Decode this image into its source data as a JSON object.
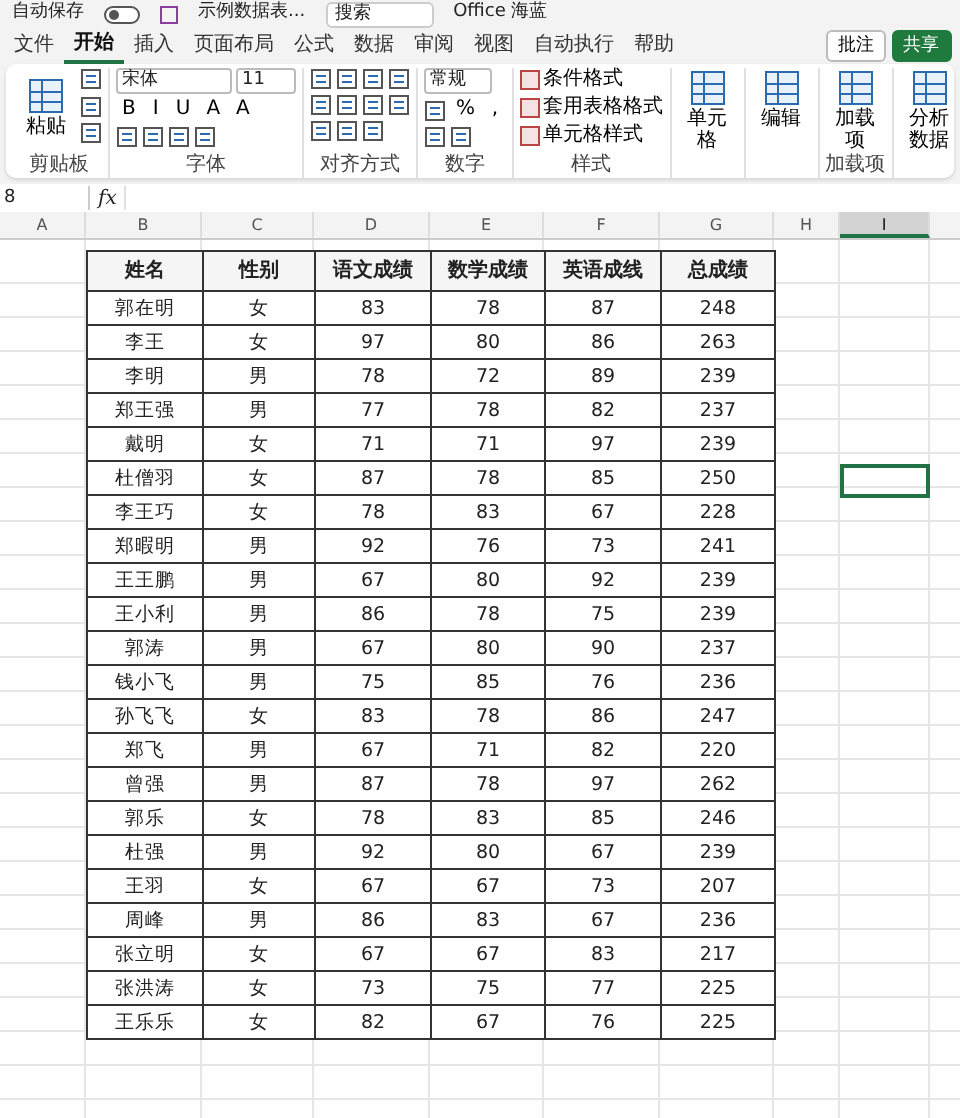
{
  "title_bar": {
    "autosave": "自动保存",
    "document": "示例数据表...",
    "search": "搜索",
    "account": "Office 海蓝"
  },
  "tabs": [
    {
      "label": "文件",
      "selected": false
    },
    {
      "label": "开始",
      "selected": true
    },
    {
      "label": "插入",
      "selected": false
    },
    {
      "label": "页面布局",
      "selected": false
    },
    {
      "label": "公式",
      "selected": false
    },
    {
      "label": "数据",
      "selected": false
    },
    {
      "label": "审阅",
      "selected": false
    },
    {
      "label": "视图",
      "selected": false
    },
    {
      "label": "自动执行",
      "selected": false
    },
    {
      "label": "帮助",
      "selected": false
    }
  ],
  "tab_buttons": [
    {
      "label": "批注",
      "kind": "outline"
    },
    {
      "label": "共享",
      "kind": "primary"
    }
  ],
  "ribbon_groups": [
    {
      "label": "剪贴板",
      "tool_lines": [
        {
          "tools": [
            {
              "kind": "big",
              "label": "粘贴"
            },
            {
              "kind": "stack",
              "tools": [
                {
                  "kind": "icon"
                },
                {
                  "kind": "icon"
                },
                {
                  "kind": "icon"
                }
              ]
            }
          ]
        }
      ]
    },
    {
      "label": "字体",
      "tool_lines": [
        {
          "tools": [
            {
              "kind": "dropdown",
              "value": "宋体"
            },
            {
              "kind": "dropdown",
              "value": "11"
            }
          ]
        },
        {
          "tools": [
            {
              "kind": "glyph",
              "text": "B"
            },
            {
              "kind": "glyph",
              "text": "I"
            },
            {
              "kind": "glyph",
              "text": "U"
            },
            {
              "kind": "glyph",
              "text": "A"
            },
            {
              "kind": "glyph",
              "text": "A"
            }
          ]
        },
        {
          "tools": [
            {
              "kind": "icon"
            },
            {
              "kind": "icon"
            },
            {
              "kind": "icon"
            },
            {
              "kind": "icon"
            }
          ]
        }
      ]
    },
    {
      "label": "对齐方式",
      "tool_lines": [
        {
          "tools": [
            {
              "kind": "icon"
            },
            {
              "kind": "icon"
            },
            {
              "kind": "icon"
            },
            {
              "kind": "icon"
            }
          ]
        },
        {
          "tools": [
            {
              "kind": "icon"
            },
            {
              "kind": "icon"
            },
            {
              "kind": "icon"
            },
            {
              "kind": "icon"
            }
          ]
        },
        {
          "tools": [
            {
              "kind": "icon"
            },
            {
              "kind": "icon"
            },
            {
              "kind": "icon"
            }
          ]
        }
      ]
    },
    {
      "label": "数字",
      "tool_lines": [
        {
          "tools": [
            {
              "kind": "dropdown",
              "value": "常规"
            }
          ]
        },
        {
          "tools": [
            {
              "kind": "icon"
            },
            {
              "kind": "glyph",
              "text": "%"
            },
            {
              "kind": "glyph",
              "text": ","
            }
          ]
        },
        {
          "tools": [
            {
              "kind": "icon"
            },
            {
              "kind": "icon"
            }
          ]
        }
      ]
    },
    {
      "label": "样式",
      "tool_lines": [
        {
          "tools": [
            {
              "kind": "menu",
              "label": "条件格式"
            }
          ]
        },
        {
          "tools": [
            {
              "kind": "menu",
              "label": "套用表格格式"
            }
          ]
        },
        {
          "tools": [
            {
              "kind": "menu",
              "label": "单元格样式"
            }
          ]
        }
      ]
    },
    {
      "tool_lines": [
        {
          "tools": [
            {
              "kind": "big",
              "label": "单元格"
            }
          ]
        }
      ]
    },
    {
      "tool_lines": [
        {
          "tools": [
            {
              "kind": "big",
              "label": "编辑"
            }
          ]
        }
      ]
    },
    {
      "label": "加载项",
      "tool_lines": [
        {
          "tools": [
            {
              "kind": "big",
              "label": "加载项"
            }
          ]
        }
      ]
    },
    {
      "tool_lines": [
        {
          "tools": [
            {
              "kind": "big",
              "label": "分析数据"
            }
          ]
        }
      ]
    }
  ],
  "name_box": "8",
  "formula_symbol": "fx",
  "column_headers": [
    {
      "label": "A",
      "selected": false
    },
    {
      "label": "B",
      "selected": false
    },
    {
      "label": "C",
      "selected": false
    },
    {
      "label": "D",
      "selected": false
    },
    {
      "label": "E",
      "selected": false
    },
    {
      "label": "F",
      "selected": false
    },
    {
      "label": "G",
      "selected": false
    },
    {
      "label": "H",
      "selected": false
    },
    {
      "label": "I",
      "selected": true
    }
  ],
  "table": {
    "columns": [
      "姓名",
      "性别",
      "语文成绩",
      "数学成绩",
      "英语成线",
      "总成绩"
    ],
    "rows": [
      [
        "郭在明",
        "女",
        "83",
        "78",
        "87",
        "248"
      ],
      [
        "李王",
        "女",
        "97",
        "80",
        "86",
        "263"
      ],
      [
        "李明",
        "男",
        "78",
        "72",
        "89",
        "239"
      ],
      [
        "郑王强",
        "男",
        "77",
        "78",
        "82",
        "237"
      ],
      [
        "戴明",
        "女",
        "71",
        "71",
        "97",
        "239"
      ],
      [
        "杜僧羽",
        "女",
        "87",
        "78",
        "85",
        "250"
      ],
      [
        "李王巧",
        "女",
        "78",
        "83",
        "67",
        "228"
      ],
      [
        "郑暇明",
        "男",
        "92",
        "76",
        "73",
        "241"
      ],
      [
        "王王鹏",
        "男",
        "67",
        "80",
        "92",
        "239"
      ],
      [
        "王小利",
        "男",
        "86",
        "78",
        "75",
        "239"
      ],
      [
        "郭涛",
        "男",
        "67",
        "80",
        "90",
        "237"
      ],
      [
        "钱小飞",
        "男",
        "75",
        "85",
        "76",
        "236"
      ],
      [
        "孙飞飞",
        "女",
        "83",
        "78",
        "86",
        "247"
      ],
      [
        "郑飞",
        "男",
        "67",
        "71",
        "82",
        "220"
      ],
      [
        "曾强",
        "男",
        "87",
        "78",
        "97",
        "262"
      ],
      [
        "郭乐",
        "女",
        "78",
        "83",
        "85",
        "246"
      ],
      [
        "杜强",
        "男",
        "92",
        "80",
        "67",
        "239"
      ],
      [
        "王羽",
        "女",
        "67",
        "67",
        "73",
        "207"
      ],
      [
        "周峰",
        "男",
        "86",
        "83",
        "67",
        "236"
      ],
      [
        "张立明",
        "女",
        "67",
        "67",
        "83",
        "217"
      ],
      [
        "张洪涛",
        "女",
        "73",
        "75",
        "77",
        "225"
      ],
      [
        "王乐乐",
        "女",
        "82",
        "67",
        "76",
        "225"
      ]
    ]
  }
}
